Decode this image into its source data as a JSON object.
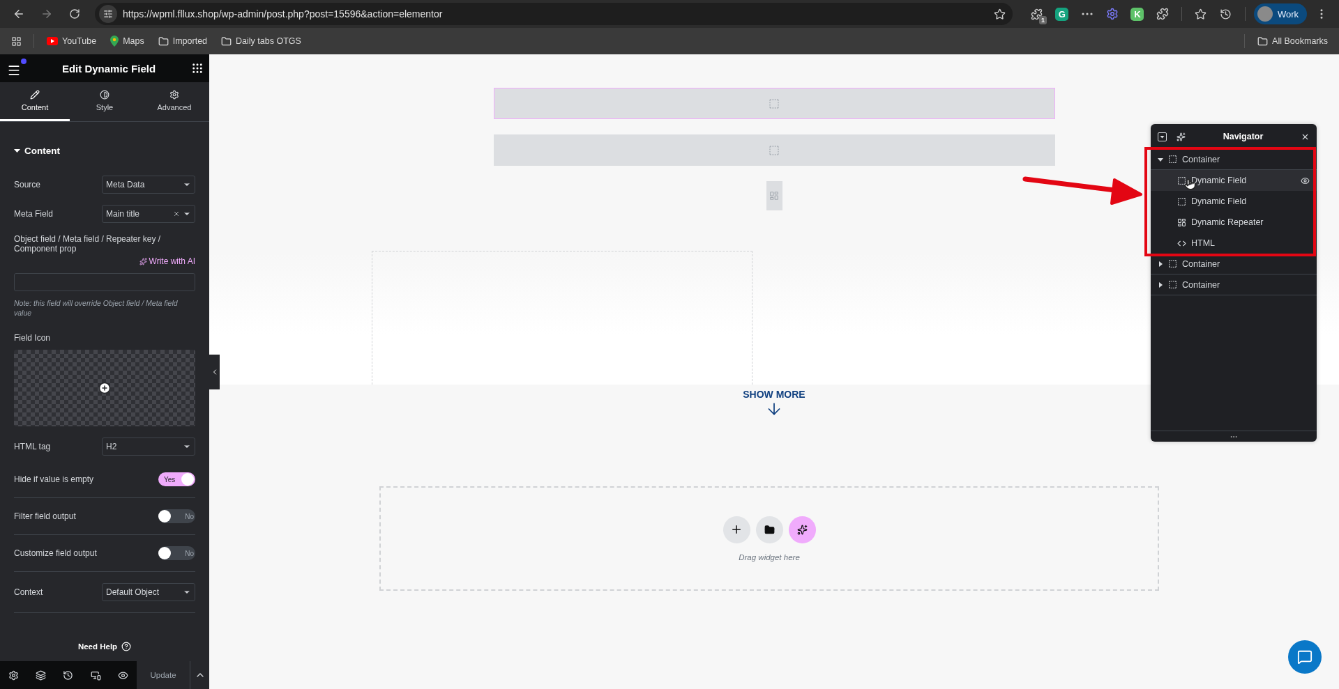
{
  "browser": {
    "url": "https://wpml.fllux.shop/wp-admin/post.php?post=15596&action=elementor",
    "extensions": [
      {
        "kind": "badge",
        "badge": "1"
      },
      {
        "kind": "letter",
        "label": "G",
        "color": "#15a37f"
      },
      {
        "kind": "dots"
      },
      {
        "kind": "gear"
      },
      {
        "kind": "letter",
        "label": "K",
        "color": "#5ec269"
      },
      {
        "kind": "puzzle"
      }
    ],
    "profile": "Work",
    "bookmarks": [
      {
        "kind": "youtube",
        "label": "YouTube"
      },
      {
        "kind": "maps",
        "label": "Maps"
      },
      {
        "kind": "folder",
        "label": "Imported"
      },
      {
        "kind": "folder",
        "label": "Daily tabs OTGS"
      }
    ],
    "all_bookmarks": "All Bookmarks"
  },
  "panel": {
    "title": "Edit Dynamic Field",
    "tabs": [
      {
        "kind": "pencil",
        "label": "Content",
        "selected": true
      },
      {
        "kind": "contrast",
        "label": "Style",
        "selected": false
      },
      {
        "kind": "gear",
        "label": "Advanced",
        "selected": false
      }
    ],
    "section": {
      "title": "Content",
      "expanded": true
    },
    "fields": [
      {
        "kind": "select",
        "label": "Source",
        "value": "Meta Data"
      },
      {
        "kind": "select",
        "label": "Meta Field",
        "value": "Main title",
        "clearable": true
      },
      {
        "kind": "text",
        "label": "Object field / Meta field / Repeater key / Component prop",
        "action": "Write with AI",
        "note": "Note: this field will override Object field / Meta field value"
      },
      {
        "kind": "media",
        "label": "Field Icon"
      },
      {
        "kind": "select",
        "label": "HTML tag",
        "value": "H2"
      },
      {
        "kind": "switch",
        "label": "Hide if value is empty",
        "on": true,
        "text": "Yes"
      },
      {
        "kind": "switch",
        "label": "Filter field output",
        "on": false,
        "text": "No"
      },
      {
        "kind": "switch",
        "label": "Customize field output",
        "on": false,
        "text": "No"
      },
      {
        "kind": "select",
        "label": "Context",
        "value": "Default Object"
      }
    ],
    "help": "Need Help",
    "update": "Update"
  },
  "canvas": {
    "show_more": "SHOW MORE",
    "drop_hint": "Drag widget here"
  },
  "navigator": {
    "title": "Navigator",
    "items": [
      {
        "kind": "container",
        "label": "Container",
        "expanded": true,
        "selected": false,
        "children": [
          {
            "kind": "field",
            "label": "Dynamic Field",
            "selected": true
          },
          {
            "kind": "field",
            "label": "Dynamic Field",
            "selected": false
          },
          {
            "kind": "repeater",
            "label": "Dynamic Repeater",
            "selected": false
          },
          {
            "kind": "html",
            "label": "HTML",
            "selected": false
          }
        ]
      },
      {
        "kind": "container",
        "label": "Container",
        "expanded": false,
        "selected": false
      },
      {
        "kind": "container",
        "label": "Container",
        "expanded": false,
        "selected": false
      }
    ]
  }
}
